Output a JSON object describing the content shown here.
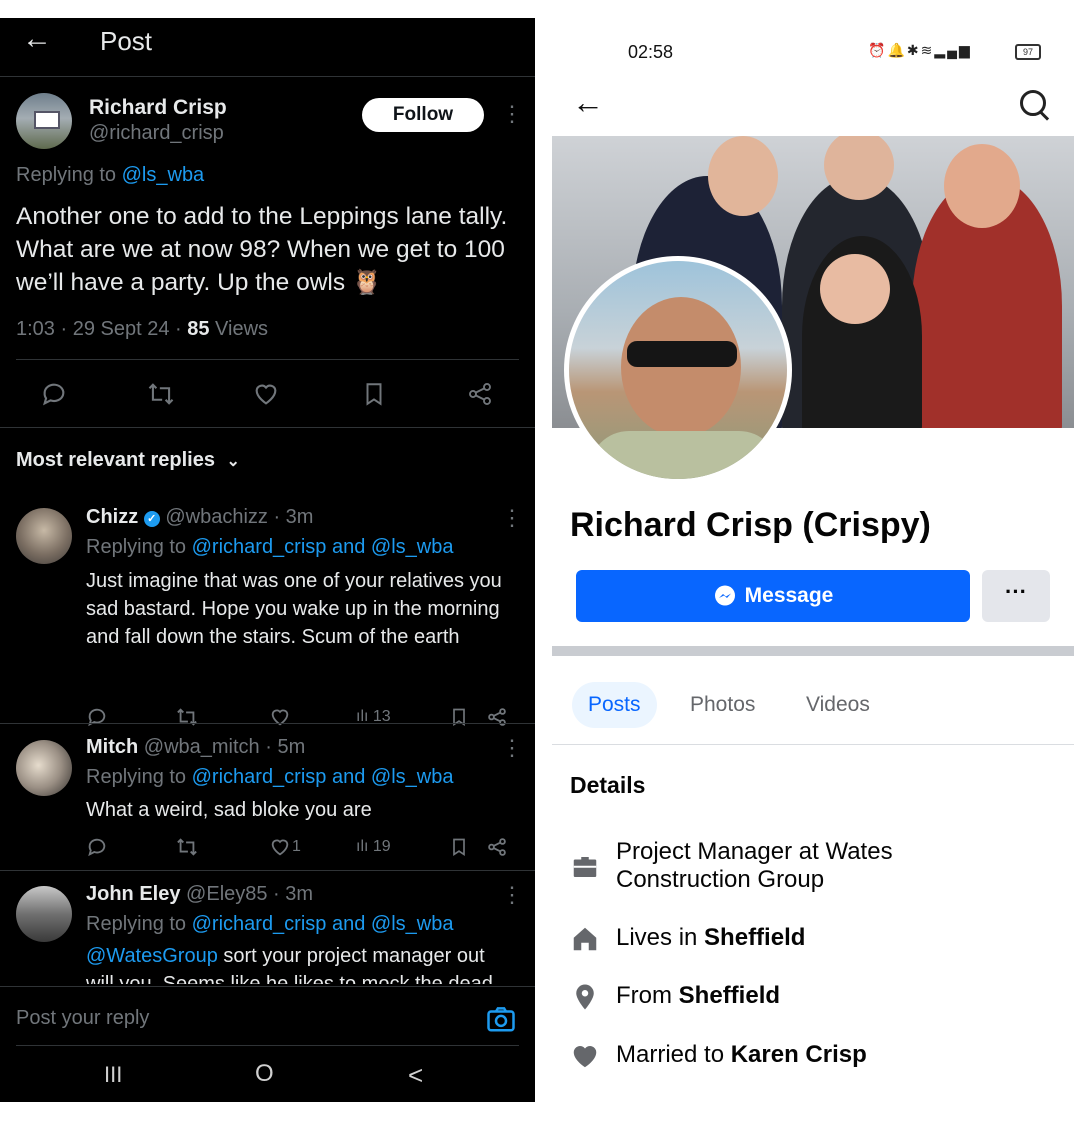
{
  "x": {
    "header": {
      "back_glyph": "←",
      "title": "Post"
    },
    "post": {
      "author_name": "Richard Crisp",
      "author_handle": "@richard_crisp",
      "follow_label": "Follow",
      "replying_prefix": "Replying to ",
      "replying_to": "@ls_wba",
      "text": "Another one to add to the Leppings lane tally. What are we at now 98? When we get to 100 we’ll have a party. Up the owls 🦉",
      "meta_time": "1:03 · 29 Sept 24 · ",
      "views_count": "85",
      "views_label": " Views"
    },
    "replies_header": "Most relevant replies",
    "replies": [
      {
        "name": "Chizz",
        "handle_time": "@wbachizz · 3m",
        "replying_prefix": "Replying to ",
        "replying_to": "@richard_crisp and @ls_wba",
        "text": "Just imagine that was one of your relatives you sad bastard. Hope you wake up in the morning and fall down the stairs. Scum of the earth",
        "like_count": "",
        "views": "13"
      },
      {
        "name": "Mitch",
        "handle_time": "@wba_mitch · 5m",
        "replying_prefix": "Replying to ",
        "replying_to": "@richard_crisp and @ls_wba",
        "text": "What a weird, sad bloke you are",
        "like_count": "1",
        "views": "19"
      },
      {
        "name": "John Eley",
        "handle_time": "@Eley85 · 3m",
        "replying_prefix": "Replying to ",
        "replying_to": "@richard_crisp and @ls_wba",
        "mention": "@WatesGroup",
        "text": " sort your project manager out",
        "text_cut": "will you. Seems like he likes to mock the dead"
      }
    ],
    "reply_placeholder": "Post your reply",
    "nav": {
      "recents": "III",
      "home": "O",
      "back": "<"
    }
  },
  "fb": {
    "status": {
      "time": "02:58",
      "battery": "97"
    },
    "profile_name": "Richard Crisp (Crispy)",
    "message_label": "Message",
    "more_label": "···",
    "tabs": [
      "Posts",
      "Photos",
      "Videos"
    ],
    "details_title": "Details",
    "details": [
      {
        "icon": "briefcase-icon",
        "line1": "Project Manager at Wates",
        "line2": "Construction Group"
      },
      {
        "icon": "home-icon",
        "prefix": "Lives in ",
        "bold": "Sheffield"
      },
      {
        "icon": "location-pin-icon",
        "prefix": "From ",
        "bold": "Sheffield"
      },
      {
        "icon": "heart-icon",
        "prefix": "Married to ",
        "bold": "Karen Crisp"
      }
    ],
    "colors": {
      "accent": "#0866ff",
      "tab_bg": "#ebf5ff"
    }
  }
}
